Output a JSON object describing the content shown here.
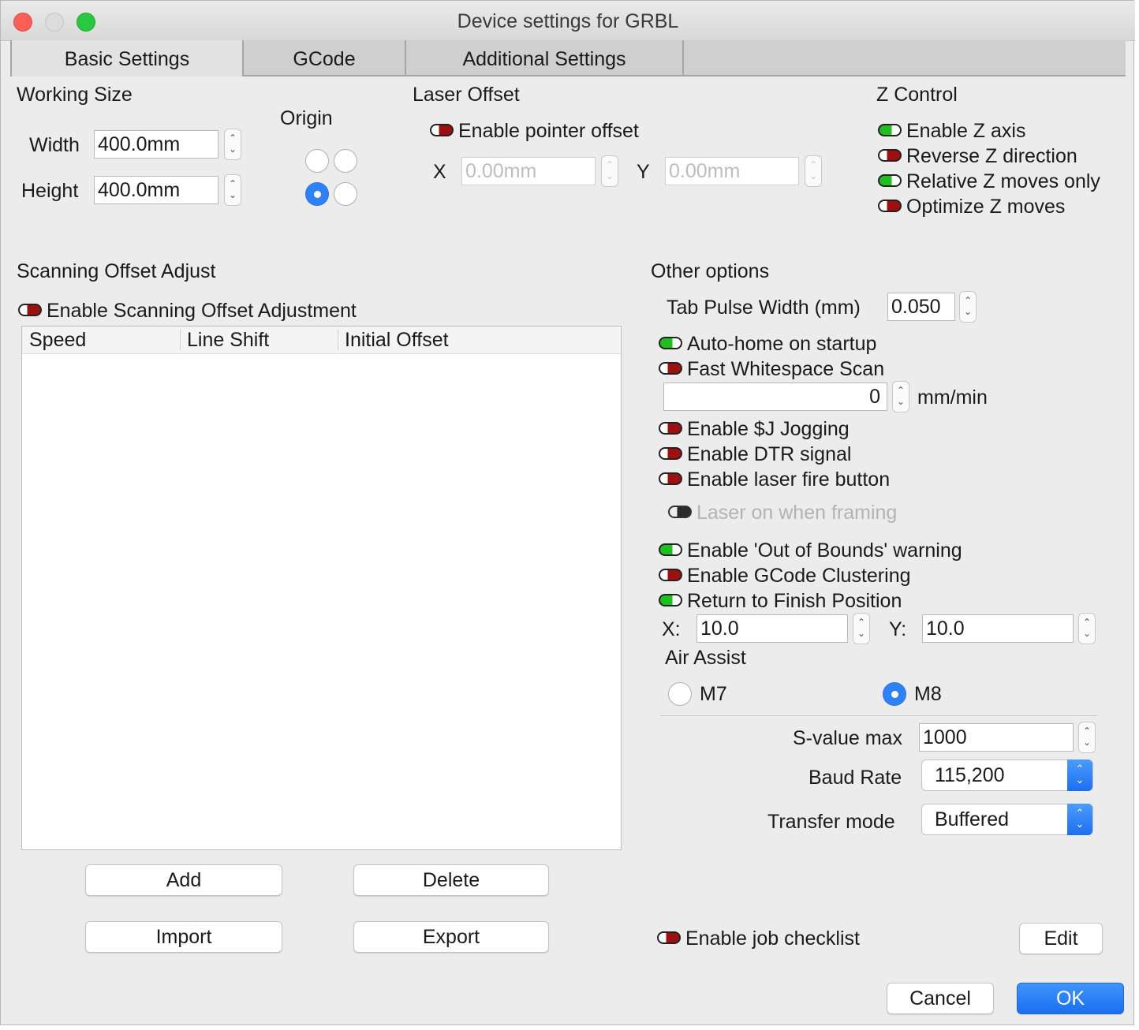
{
  "window": {
    "title": "Device settings for GRBL"
  },
  "colors": {
    "accent": "#2f82f6",
    "toggle_on": "#1fbf1f",
    "toggle_off": "#9e0f0f",
    "close": "#fc5f57",
    "minimize": "#dcdcdc",
    "zoom": "#28c840"
  },
  "tabs": [
    {
      "label": "Basic Settings",
      "selected": true
    },
    {
      "label": "GCode",
      "selected": false
    },
    {
      "label": "Additional Settings",
      "selected": false
    }
  ],
  "working_size": {
    "heading": "Working Size",
    "width_label": "Width",
    "width_value": "400.0mm",
    "height_label": "Height",
    "height_value": "400.0mm"
  },
  "origin": {
    "heading": "Origin",
    "selected": "bottom-left"
  },
  "laser_offset": {
    "heading": "Laser Offset",
    "enable_label": "Enable pointer offset",
    "enabled": false,
    "x_label": "X",
    "x_value": "0.00mm",
    "y_label": "Y",
    "y_value": "0.00mm"
  },
  "z_control": {
    "heading": "Z Control",
    "items": [
      {
        "label": "Enable Z axis",
        "on": true
      },
      {
        "label": "Reverse Z direction",
        "on": false
      },
      {
        "label": "Relative Z moves only",
        "on": true
      },
      {
        "label": "Optimize Z moves",
        "on": false
      }
    ]
  },
  "scanning": {
    "heading": "Scanning Offset Adjust",
    "enable_label": "Enable Scanning Offset Adjustment",
    "enabled": false,
    "columns": [
      "Speed",
      "Line Shift",
      "Initial Offset"
    ],
    "rows": [],
    "buttons": {
      "add": "Add",
      "delete": "Delete",
      "import": "Import",
      "export": "Export"
    }
  },
  "other": {
    "heading": "Other options",
    "tab_pulse_label": "Tab Pulse Width (mm)",
    "tab_pulse_value": "0.050",
    "auto_home": {
      "label": "Auto-home on startup",
      "on": true
    },
    "fast_ws": {
      "label": "Fast Whitespace Scan",
      "on": false
    },
    "fast_ws_value": "0",
    "fast_ws_unit": "mm/min",
    "jogging": {
      "label": "Enable $J Jogging",
      "on": false
    },
    "dtr": {
      "label": "Enable DTR signal",
      "on": false
    },
    "fire_button": {
      "label": "Enable laser fire button",
      "on": false
    },
    "laser_framing": {
      "label": "Laser on when framing",
      "on": false,
      "disabled": true
    },
    "out_of_bounds": {
      "label": "Enable 'Out of Bounds' warning",
      "on": true
    },
    "clustering": {
      "label": "Enable GCode Clustering",
      "on": false
    },
    "return_finish": {
      "label": "Return to Finish Position",
      "on": true
    },
    "finish_x_label": "X:",
    "finish_x_value": "10.0",
    "finish_y_label": "Y:",
    "finish_y_value": "10.0",
    "air_assist": {
      "heading": "Air Assist",
      "options": [
        "M7",
        "M8"
      ],
      "selected": "M8"
    },
    "s_value_label": "S-value max",
    "s_value": "1000",
    "baud_label": "Baud Rate",
    "baud_value": "115,200",
    "transfer_label": "Transfer mode",
    "transfer_value": "Buffered"
  },
  "checklist": {
    "label": "Enable job checklist",
    "on": false,
    "edit": "Edit"
  },
  "footer": {
    "cancel": "Cancel",
    "ok": "OK"
  }
}
